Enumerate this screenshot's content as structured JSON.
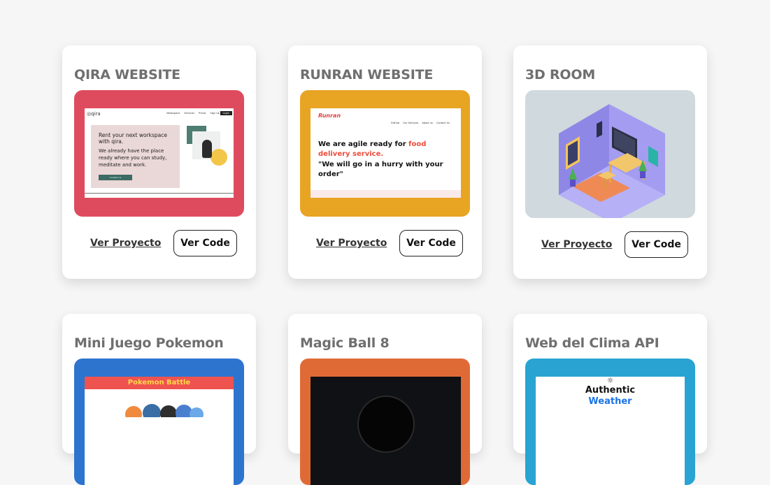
{
  "colors": {
    "page_bg": "#f6f6f6",
    "qira": "#df4b5e",
    "runran": "#e8a423",
    "room": "#cfd9de",
    "pokemon": "#2d74cf",
    "magic": "#e06a36",
    "clima": "#29a4d2"
  },
  "projects": [
    {
      "title": "QIRA WEBSITE",
      "view_label": "Ver Proyecto",
      "code_label": "Ver Code",
      "preview": {
        "logo": "qira",
        "nav": [
          "Workspace",
          "Services",
          "Prices",
          "Sign Up"
        ],
        "login": "Login",
        "text1": "Rent your next workspace with qira.",
        "text2": "We already have the place ready where you can study, meditate and work.",
        "cta": "Contact Us"
      }
    },
    {
      "title": "RUNRAN WEBSITE",
      "view_label": "Ver Proyecto",
      "code_label": "Ver Code",
      "preview": {
        "logo": "Runran",
        "nav": [
          "GitHub",
          "Our Services",
          "About us",
          "Contact Us"
        ],
        "text1a": "We are agile ready for ",
        "text1b": "food delivery service.",
        "text2": "\"We will go in a hurry with your order\""
      }
    },
    {
      "title": "3D ROOM",
      "view_label": "Ver Proyecto",
      "code_label": "Ver Code"
    },
    {
      "title": "Mini Juego Pokemon",
      "preview": {
        "banner": "Pokemon Battle"
      }
    },
    {
      "title": "Magic Ball 8"
    },
    {
      "title": "Web del Clima API",
      "preview": {
        "sun": "☼",
        "line1": "Authentic",
        "line2": "Weather"
      }
    }
  ]
}
